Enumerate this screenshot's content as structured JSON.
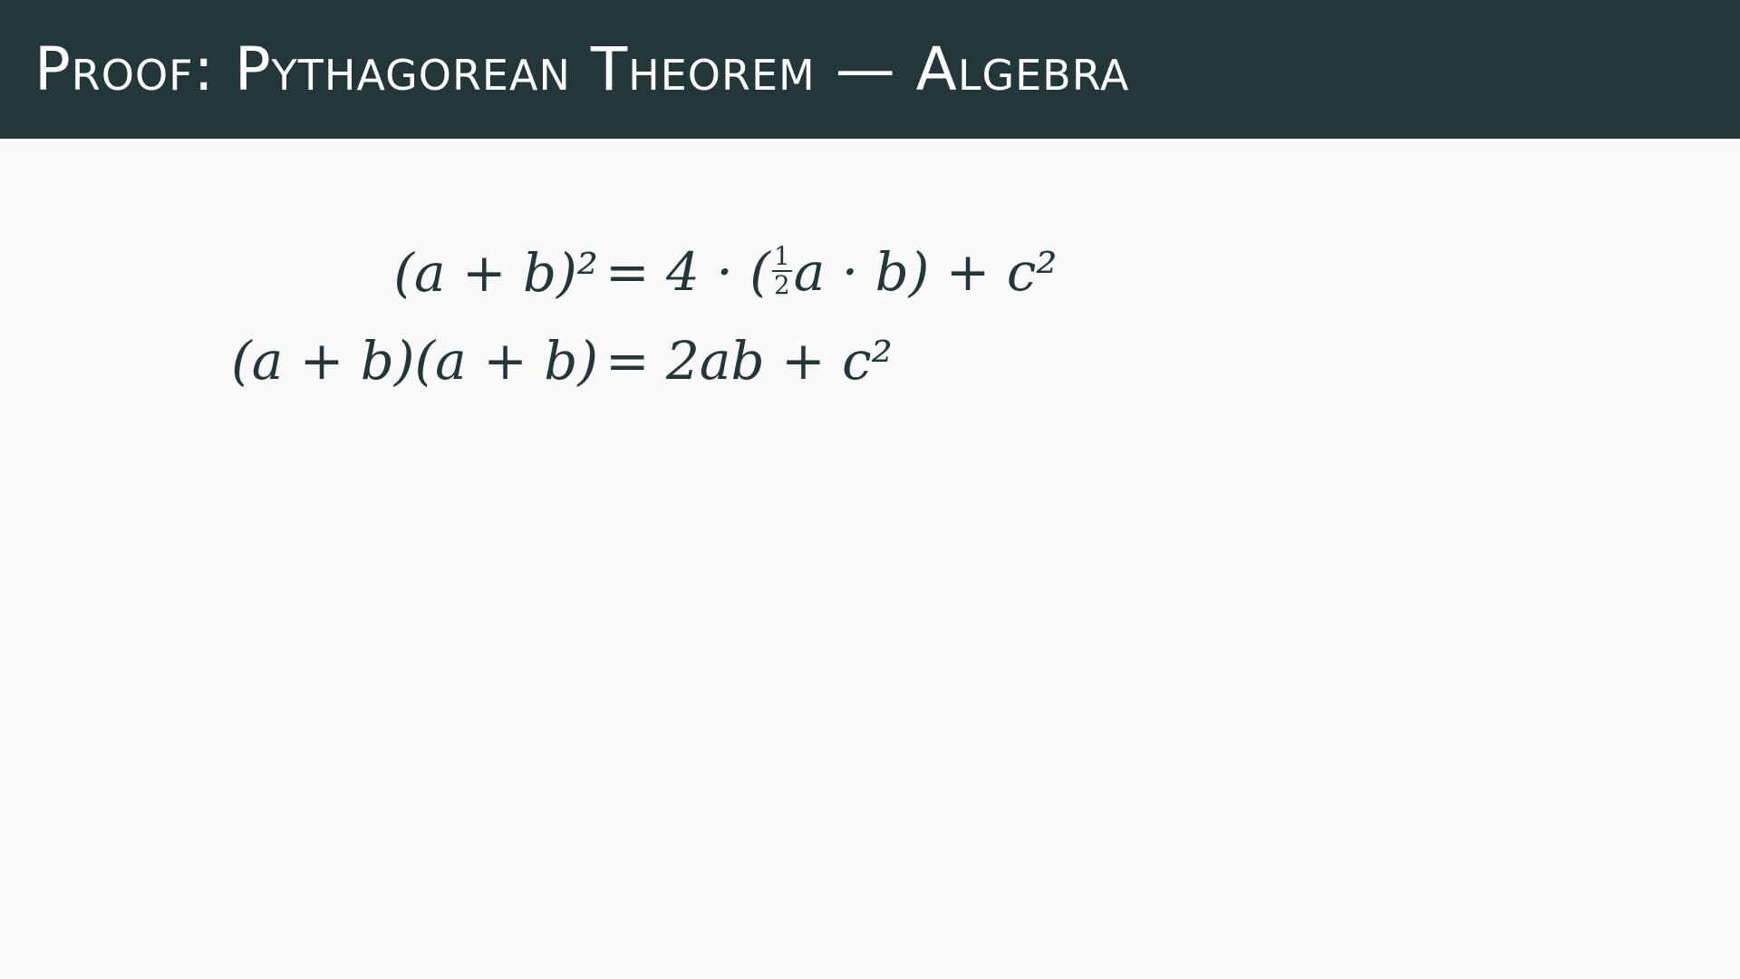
{
  "title": "Proof: Pythagorean Theorem — Algebra",
  "colors": {
    "title_bar": "#23373b",
    "background": "#fafafa",
    "text": "#23373b"
  },
  "equations": [
    {
      "lhs": "(a + b)²",
      "rhs_before_frac": "= 4 · (",
      "frac_num": "1",
      "frac_den": "2",
      "rhs_after_frac": "a · b) + c²"
    },
    {
      "lhs": "(a + b)(a + b)",
      "rhs": "= 2ab + c²"
    }
  ]
}
